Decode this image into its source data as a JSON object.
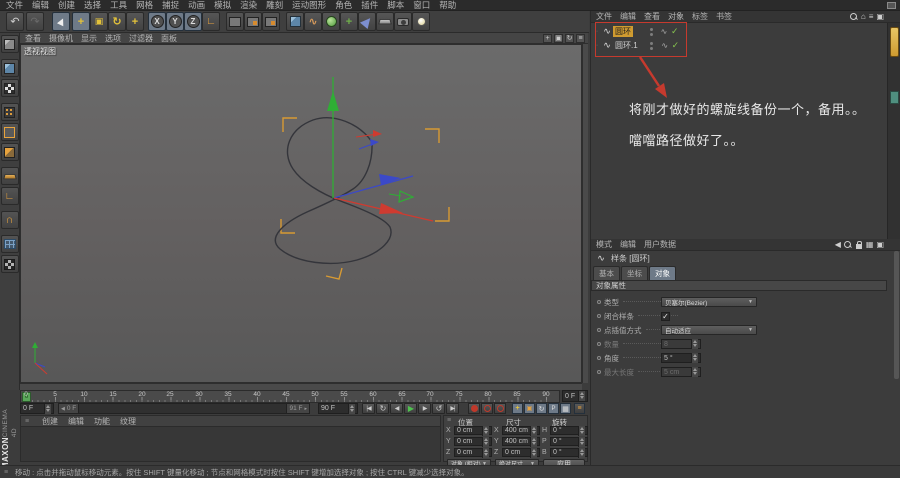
{
  "icons": {
    "undo": "↶",
    "redo": "↷",
    "rotate": "↻",
    "loop": "↺",
    "wave": "∿",
    "angle": "∟",
    "magnet": "∩",
    "check": "✓",
    "dropdown_arrow": "▼",
    "grip": "≡",
    "home": "⌂",
    "left": "◀",
    "right": "▶",
    "to_start": "|◀",
    "to_end": "▶|",
    "plus": "+",
    "box": "▣",
    "small_right": "▸",
    "clock": "◷",
    "grid": "▦",
    "p": "P"
  },
  "menubar": {
    "items": [
      "文件",
      "编辑",
      "创建",
      "选择",
      "工具",
      "网格",
      "捕捉",
      "动画",
      "模拟",
      "渲染",
      "雕刻",
      "运动图形",
      "角色",
      "插件",
      "脚本",
      "窗口",
      "帮助"
    ]
  },
  "toolbar": {
    "axis_buttons": [
      "X",
      "Y",
      "Z"
    ]
  },
  "viewport": {
    "menu": [
      "查看",
      "摄像机",
      "显示",
      "选项",
      "过滤器",
      "面板"
    ],
    "label": "透视视图"
  },
  "timeline": {
    "ticks": [
      "0",
      "5",
      "10",
      "15",
      "20",
      "25",
      "30",
      "35",
      "40",
      "45",
      "50",
      "55",
      "60",
      "65",
      "70",
      "75",
      "80",
      "85",
      "90"
    ],
    "playhead": "0",
    "current_frame": "0 F",
    "slider_start": "0 F",
    "slider_end": "91 F",
    "range_end": "90 F"
  },
  "transport": {
    "buttons": [
      "|◀",
      "↻",
      "◀",
      "▶",
      "▶",
      "↺",
      "▶|"
    ]
  },
  "materials": {
    "menu": [
      "创建",
      "编辑",
      "功能",
      "纹理"
    ]
  },
  "coordinates": {
    "columns": [
      {
        "title": "位置",
        "rows": [
          {
            "label": "X",
            "value": "0 cm"
          },
          {
            "label": "Y",
            "value": "0 cm"
          },
          {
            "label": "Z",
            "value": "0 cm"
          }
        ]
      },
      {
        "title": "尺寸",
        "rows": [
          {
            "label": "X",
            "value": "400 cm"
          },
          {
            "label": "Y",
            "value": "400 cm"
          },
          {
            "label": "Z",
            "value": "0 cm"
          }
        ]
      },
      {
        "title": "旋转",
        "rows": [
          {
            "label": "H",
            "value": "0 °"
          },
          {
            "label": "P",
            "value": "0 °"
          },
          {
            "label": "B",
            "value": "0 °"
          }
        ]
      }
    ],
    "mode_object": "对象 (相对)",
    "mode_size": "绝对尺寸",
    "apply_label": "应用"
  },
  "object_manager": {
    "menu": [
      "文件",
      "编辑",
      "查看",
      "对象",
      "标签",
      "书签"
    ],
    "objects": [
      {
        "name": "圆环"
      },
      {
        "name": "圆环.1"
      }
    ]
  },
  "annotation": {
    "line1": "将刚才做好的螺旋线备份一个，备用。。",
    "line2": "噹噹路径做好了。。"
  },
  "attributes": {
    "menu": [
      "模式",
      "编辑",
      "用户数据"
    ],
    "object_title": "样条 [圆环]",
    "tabs": [
      "基本",
      "坐标",
      "对象"
    ],
    "active_tab": "对象",
    "section_title": "对象属性",
    "fields": [
      {
        "label": "类型",
        "value": "贝塞尔(Bezier)"
      },
      {
        "label": "闭合样条",
        "value": "✓"
      },
      {
        "label": "点插值方式",
        "value": "自动适应"
      },
      {
        "label": "数量",
        "value": "8"
      },
      {
        "label": "角度",
        "value": "5 °"
      },
      {
        "label": "最大长度",
        "value": "5 cm"
      }
    ]
  },
  "statusbar": {
    "text": "移动 : 点击并拖动鼠标移动元素。按住 SHIFT 键量化移动 ; 节点和网格模式时按住 SHIFT 键增加选择对象 ; 按住 CTRL 键减少选择对象。"
  },
  "logo": {
    "brand": "MAXON",
    "product": "CINEMA 4D"
  },
  "colors": {
    "accent_orange": "#cf9b30",
    "bracket_orange": "#d79a33",
    "axis_green": "#2fae35",
    "axis_blue": "#3b49c8",
    "axis_red": "#cf3b30",
    "annotation_red": "#c63a2e",
    "check_green": "#85c24f",
    "curve": "#34353b",
    "selection_blue": "#6e7a88"
  }
}
